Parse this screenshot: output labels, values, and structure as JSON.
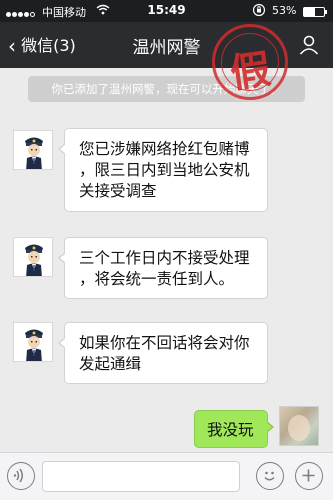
{
  "status_bar": {
    "carrier": "中国移动",
    "time": "15:49",
    "battery_percent": "53%",
    "battery_level": 0.53,
    "signal_bars": 5,
    "signal_filled": 4
  },
  "nav_bar": {
    "back_label": "微信(3)",
    "title": "温州网警"
  },
  "system_notice": "你已添加了温州网警，现在可以开始聊天了。",
  "stamp_text": "假",
  "messages": [
    {
      "from": "contact",
      "text_lines": [
        "您已涉嫌网络抢红包赌博",
        "，限三日内到当地公安机",
        "关接受调查"
      ]
    },
    {
      "from": "contact",
      "text_lines": [
        "三个工作日内不接受处理",
        "，将会统一责任到人。"
      ]
    },
    {
      "from": "contact",
      "text_lines": [
        "如果你在不回话将会对你",
        "发起通缉"
      ]
    },
    {
      "from": "me",
      "text_lines": [
        "我没玩"
      ]
    }
  ],
  "icons": {
    "voice": "voice-icon",
    "emoji": "emoji-icon",
    "plus": "plus-icon",
    "profile": "profile-icon",
    "back": "chevron-left-icon"
  },
  "colors": {
    "nav_bg": "#2b2c30",
    "chat_bg": "#ebebeb",
    "outgoing_bubble": "#a0e75a",
    "stamp": "#d42c2c"
  }
}
